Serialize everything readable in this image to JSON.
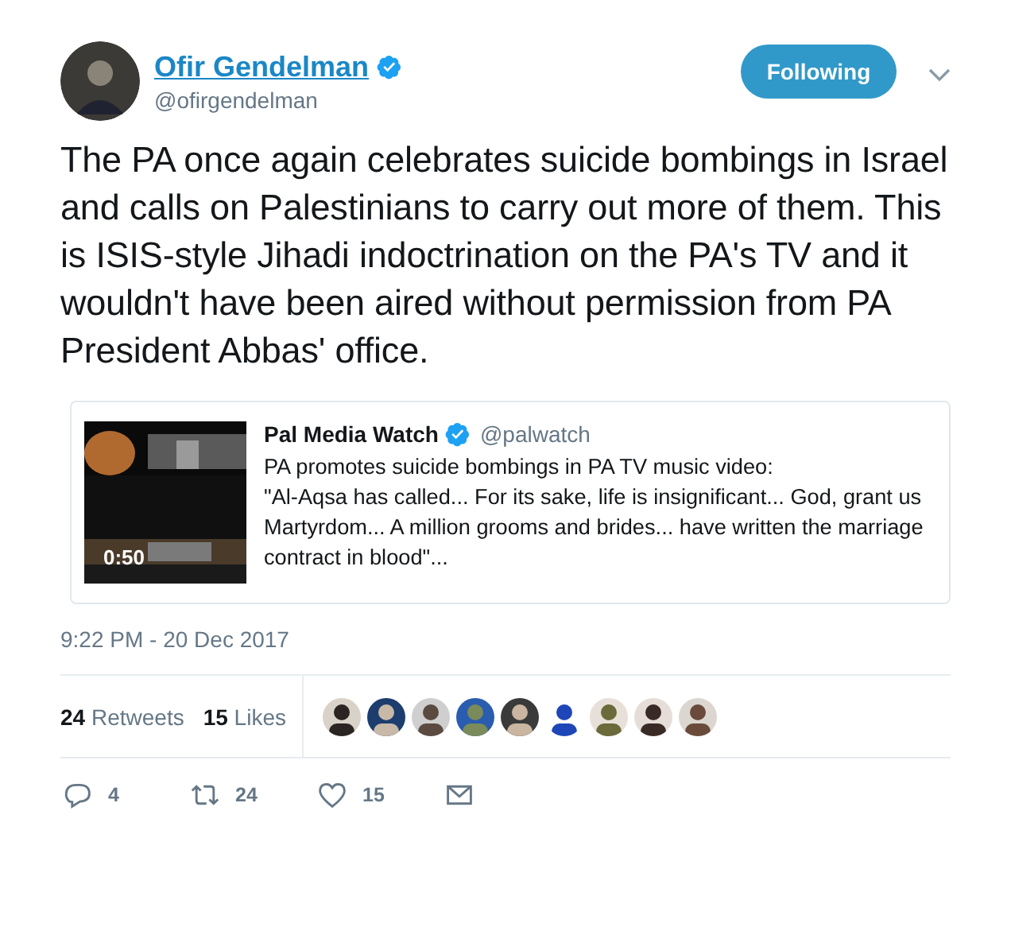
{
  "author": {
    "name": "Ofir Gendelman",
    "verified": true,
    "handle": "@ofirgendelman"
  },
  "follow_button": {
    "label": "Following",
    "selected": true
  },
  "text": "The PA once again celebrates suicide bombings in Israel and calls on Palestinians to carry out more of them. This is ISIS-style Jihadi indoctrination on the PA's TV and it wouldn't have been aired without permission from PA President Abbas' office.",
  "quoted_tweet": {
    "media": {
      "kind": "picture",
      "duration": "0:50"
    },
    "name": "Pal Media Watch",
    "verified": true,
    "handle": "@palwatch",
    "text": "PA promotes suicide bombings in PA TV music video:\n\"Al-Aqsa has called... For its sake, life is insignificant... God, grant us Martyrdom... A million grooms and brides... have written the marriage contract in blood\"..."
  },
  "timestamp": "9:22 PM - 20 Dec 2017",
  "stats": [
    {
      "count": "24",
      "label": "Retweets"
    },
    {
      "count": "15",
      "label": "Likes"
    }
  ],
  "actions": [
    {
      "kind": "reply",
      "count": "4"
    },
    {
      "kind": "retweet",
      "count": "24"
    },
    {
      "kind": "like",
      "count": "15"
    },
    {
      "kind": "message"
    }
  ]
}
